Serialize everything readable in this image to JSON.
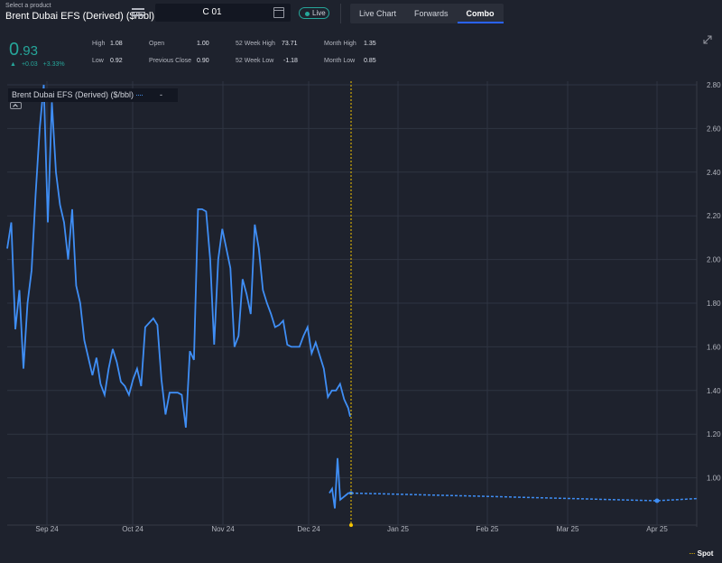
{
  "product": {
    "hint": "Select a product",
    "name": "Brent Dubai EFS (Derived) ($/bbl)"
  },
  "contract": {
    "value": "C 01"
  },
  "live_label": "Live",
  "tabs": [
    {
      "label": "Live Chart",
      "active": false
    },
    {
      "label": "Forwards",
      "active": false
    },
    {
      "label": "Combo",
      "active": true
    }
  ],
  "price": {
    "int": "0",
    "dec": ".93",
    "change": "+0.03",
    "change_pct": "+3.33%"
  },
  "stats": {
    "high_label": "High",
    "high": "1.08",
    "low_label": "Low",
    "low": "0.92",
    "open_label": "Open",
    "open": "1.00",
    "prev_label": "Previous Close",
    "prev": "0.90",
    "wk52h_label": "52 Week High",
    "wk52h": "73.71",
    "wk52l_label": "52 Week Low",
    "wk52l": "-1.18",
    "mh_label": "Month High",
    "mh": "1.35",
    "ml_label": "Month Low",
    "ml": "0.85"
  },
  "legend": {
    "name": "Brent Dubai EFS (Derived) ($/bbl)",
    "value": "-"
  },
  "spot_label": "Spot",
  "colors": {
    "line": "#3f8ef5",
    "spot": "#f7c600",
    "up": "#26a69a"
  },
  "chart_data": {
    "type": "line",
    "y_ticks": [
      "2.80",
      "2.60",
      "2.40",
      "2.20",
      "2.00",
      "1.80",
      "1.60",
      "1.40",
      "1.20",
      "1.00"
    ],
    "y_range": [
      0.8,
      2.8
    ],
    "x_ticks": [
      "Sep 24",
      "Oct 24",
      "Nov 24",
      "Dec 24",
      "Jan 25",
      "Feb 25",
      "Mar 25",
      "Apr 25"
    ],
    "x_range_days": [
      -84,
      216
    ],
    "spot_day": 0,
    "series": [
      {
        "style": "solid",
        "points": [
          [
            -84,
            2.05
          ],
          [
            -83,
            2.17
          ],
          [
            -82,
            1.68
          ],
          [
            -81,
            1.86
          ],
          [
            -80,
            1.5
          ],
          [
            -79,
            1.8
          ],
          [
            -78,
            1.95
          ],
          [
            -77,
            2.3
          ],
          [
            -76,
            2.6
          ],
          [
            -75,
            2.8
          ],
          [
            -74,
            2.17
          ],
          [
            -73,
            2.72
          ],
          [
            -72,
            2.4
          ],
          [
            -71,
            2.25
          ],
          [
            -70,
            2.17
          ],
          [
            -69,
            2.0
          ],
          [
            -68,
            2.23
          ],
          [
            -67,
            1.88
          ],
          [
            -66,
            1.8
          ],
          [
            -65,
            1.63
          ],
          [
            -64,
            1.55
          ],
          [
            -63,
            1.47
          ],
          [
            -62,
            1.55
          ],
          [
            -61,
            1.43
          ],
          [
            -60,
            1.38
          ],
          [
            -59,
            1.5
          ],
          [
            -58,
            1.59
          ],
          [
            -57,
            1.53
          ],
          [
            -56,
            1.44
          ],
          [
            -55,
            1.42
          ],
          [
            -54,
            1.38
          ],
          [
            -53,
            1.45
          ],
          [
            -52,
            1.5
          ],
          [
            -51,
            1.42
          ],
          [
            -50,
            1.69
          ],
          [
            -49,
            1.71
          ],
          [
            -48,
            1.73
          ],
          [
            -47,
            1.7
          ],
          [
            -46,
            1.45
          ],
          [
            -45,
            1.29
          ],
          [
            -44,
            1.39
          ],
          [
            -43,
            1.39
          ],
          [
            -42,
            1.39
          ],
          [
            -41,
            1.38
          ],
          [
            -40,
            1.23
          ],
          [
            -39,
            1.58
          ],
          [
            -38,
            1.54
          ],
          [
            -37,
            2.23
          ],
          [
            -36,
            2.23
          ],
          [
            -35,
            2.22
          ],
          [
            -34,
            2.0
          ],
          [
            -33,
            1.61
          ],
          [
            -32,
            2.0
          ],
          [
            -31,
            2.14
          ],
          [
            -30,
            2.05
          ],
          [
            -29,
            1.96
          ],
          [
            -28,
            1.6
          ],
          [
            -27,
            1.65
          ],
          [
            -26,
            1.91
          ],
          [
            -25,
            1.84
          ],
          [
            -24,
            1.75
          ],
          [
            -23,
            2.16
          ],
          [
            -22,
            2.05
          ],
          [
            -21,
            1.86
          ],
          [
            -20,
            1.8
          ],
          [
            -19,
            1.75
          ],
          [
            -18,
            1.69
          ],
          [
            -17,
            1.7
          ],
          [
            -16,
            1.72
          ],
          [
            -15,
            1.61
          ],
          [
            -14,
            1.6
          ],
          [
            -13,
            1.6
          ],
          [
            -12,
            1.6
          ],
          [
            -11,
            1.65
          ],
          [
            -10,
            1.69
          ],
          [
            -9,
            1.57
          ],
          [
            -8,
            1.62
          ],
          [
            -7,
            1.56
          ],
          [
            -6,
            1.5
          ],
          [
            -5,
            1.37
          ],
          [
            -4,
            1.4
          ],
          [
            -3,
            1.4
          ],
          [
            -2,
            1.43
          ],
          [
            -1,
            1.36
          ],
          [
            0,
            1.32
          ],
          [
            0.5,
            1.28
          ]
        ],
        "note_unused": ""
      }
    ]
  }
}
